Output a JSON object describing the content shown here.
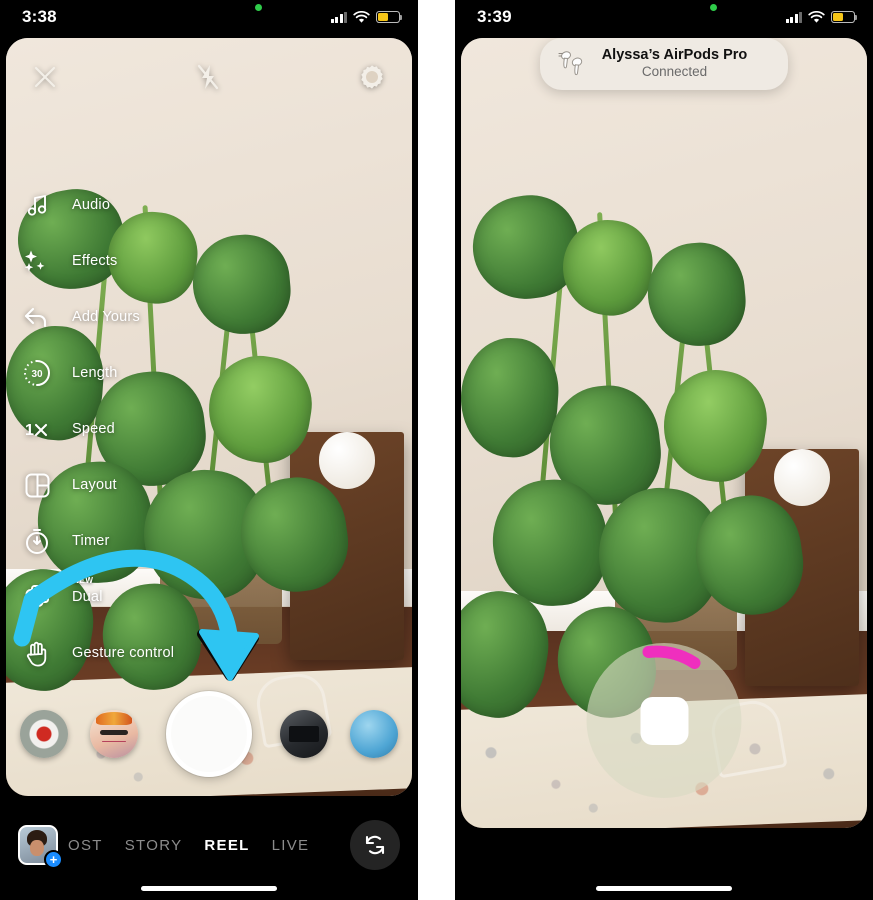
{
  "panels": [
    {
      "id": "left",
      "status_bar": {
        "time": "3:38",
        "signal_icon": "cellular-bars-icon",
        "wifi_icon": "wifi-icon",
        "battery_icon": "battery-low-power-icon",
        "recording_dot": "green-privacy-dot"
      },
      "camera_top_bar": [
        {
          "name": "close-button",
          "icon": "close-x-icon",
          "label": ""
        },
        {
          "name": "flash-button",
          "icon": "flash-off-icon",
          "label": ""
        },
        {
          "name": "settings-button",
          "icon": "gear-icon",
          "label": ""
        }
      ],
      "side_menu": [
        {
          "icon": "music-note-icon",
          "label": "Audio",
          "badge": ""
        },
        {
          "icon": "sparkles-icon",
          "label": "Effects",
          "badge": ""
        },
        {
          "icon": "reply-arrow-icon",
          "label": "Add Yours",
          "badge": ""
        },
        {
          "icon": "length-30-icon",
          "label": "Length",
          "badge": "",
          "value": "30"
        },
        {
          "icon": "speed-1x-icon",
          "label": "Speed",
          "badge": "",
          "value": "1×"
        },
        {
          "icon": "layout-grid-icon",
          "label": "Layout",
          "badge": ""
        },
        {
          "icon": "timer-icon",
          "label": "Timer",
          "badge": ""
        },
        {
          "icon": "dual-camera-icon",
          "label": "Dual",
          "badge": "NEW"
        },
        {
          "icon": "hand-icon",
          "label": "Gesture control",
          "badge": ""
        }
      ],
      "effect_tray": {
        "shutter": "shutter-button",
        "effects": [
          {
            "name": "effect-red-eye"
          },
          {
            "name": "effect-face-avatar"
          },
          {
            "name": "effect-dark-device"
          },
          {
            "name": "effect-blue-orb"
          }
        ]
      },
      "mode_bar": {
        "avatar": "user-avatar",
        "add_badge": "+",
        "modes": [
          {
            "label": "OST",
            "active": false
          },
          {
            "label": "STORY",
            "active": false
          },
          {
            "label": "REEL",
            "active": true
          },
          {
            "label": "LIVE",
            "active": false
          }
        ],
        "flip_button": "flip-camera-icon"
      }
    },
    {
      "id": "right",
      "status_bar": {
        "time": "3:39",
        "signal_icon": "cellular-bars-icon",
        "wifi_icon": "wifi-icon",
        "battery_icon": "battery-low-power-icon",
        "recording_dot": "green-privacy-dot"
      },
      "banner": {
        "icon": "airpods-pro-icon",
        "title": "Alyssa’s AirPods Pro",
        "subtitle": "Connected"
      },
      "recording": {
        "stop_button": "stop-recording-button",
        "progress_color": "#ef2fbe",
        "progress_pct": 8
      }
    }
  ],
  "annotation": {
    "type": "curved-arrow",
    "color": "#2ec5f2",
    "outline": "#0a0a0a",
    "points_to": "Gesture control"
  }
}
